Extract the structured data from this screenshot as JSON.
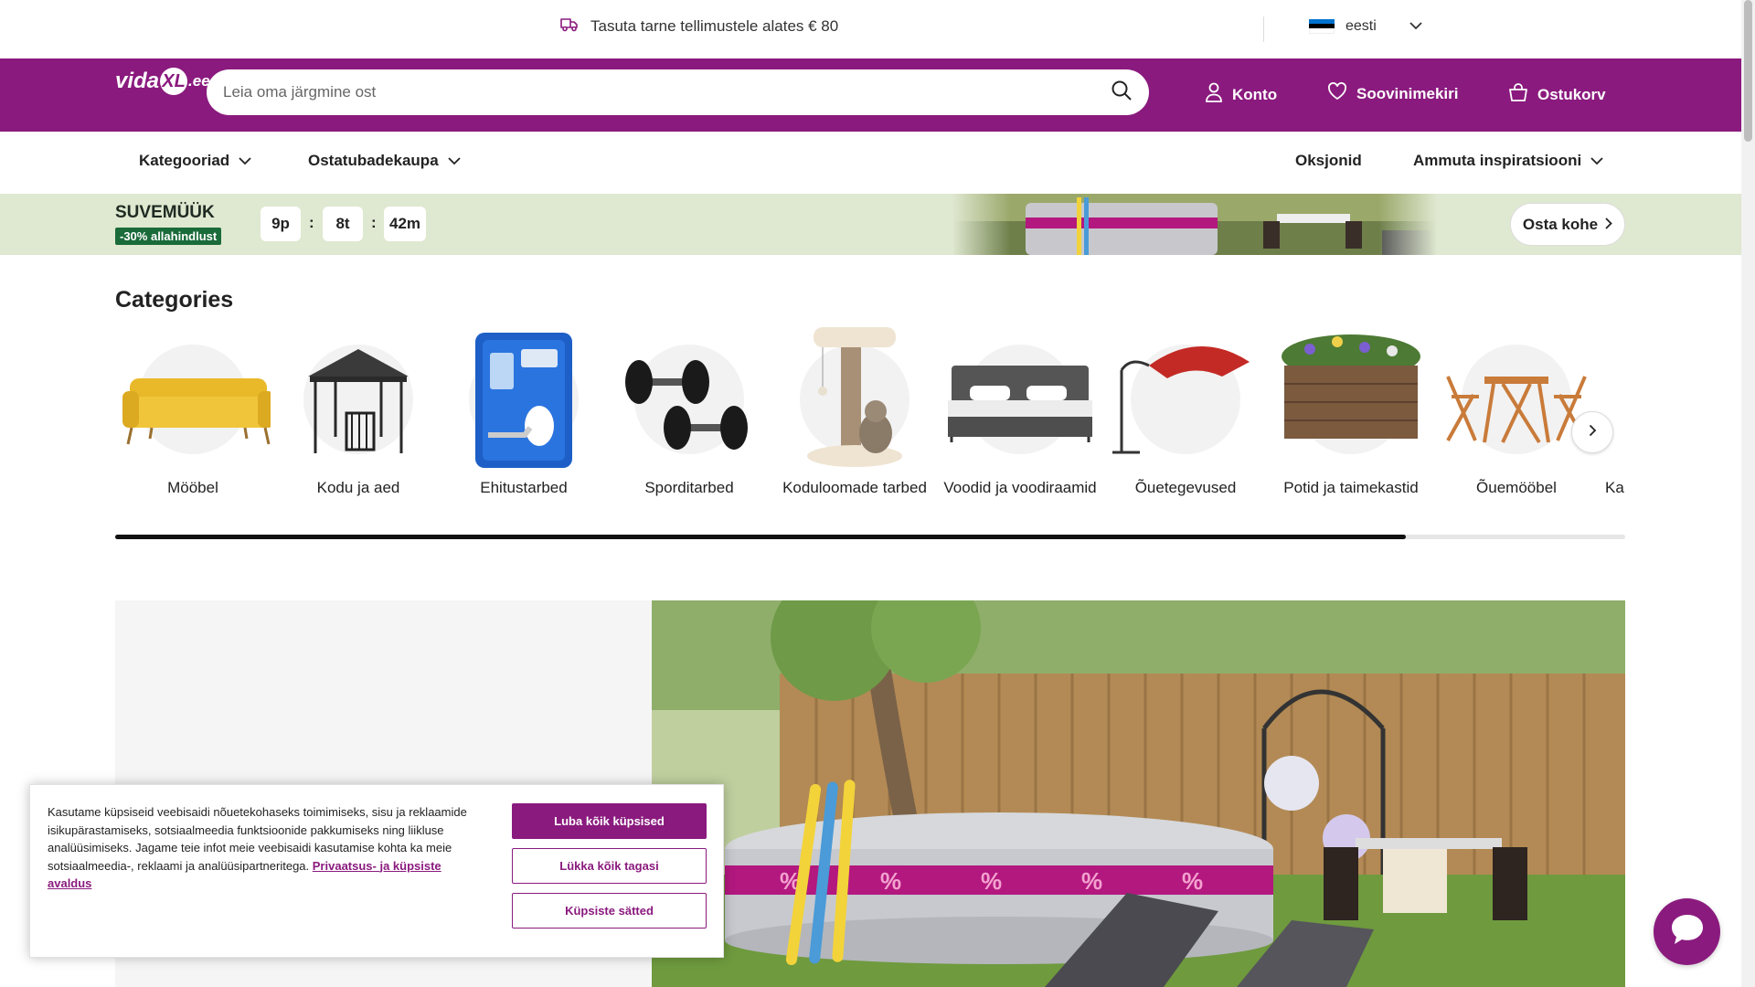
{
  "topbar": {
    "promo_icon": "delivery-truck-icon",
    "promo_text": "Tasuta tarne tellimustele alates € 80",
    "language": "eesti",
    "flag_colors": [
      "#0072ce",
      "#000000",
      "#ffffff"
    ]
  },
  "header": {
    "logo_text": "vidaXL.ee",
    "search_placeholder": "Leia oma järgmine ost",
    "account_label": "Konto",
    "wishlist_label": "Soovinimekiri",
    "cart_label": "Ostukorv",
    "brand_color": "#8a1a7e"
  },
  "nav": {
    "categories_label": "Kategooriad",
    "shop_by_room_label": "Ostatubadekaupa",
    "auctions_label": "Oksjonid",
    "inspiration_label": "Ammuta inspiratsiooni"
  },
  "sale_banner": {
    "title": "SUVEMÜÜK",
    "badge": "-30% allahindlust",
    "timer_days": "9p",
    "timer_hours": "8t",
    "timer_minutes": "42m",
    "separator": ":",
    "cta_label": "Osta kohe",
    "background_color": "#dfe8d0"
  },
  "categories": {
    "title": "Categories",
    "items": [
      {
        "label": "Mööbel",
        "icon": "sofa-icon"
      },
      {
        "label": "Kodu ja aed",
        "icon": "gazebo-icon"
      },
      {
        "label": "Ehitustarbed",
        "icon": "toolcase-icon"
      },
      {
        "label": "Sporditarbed",
        "icon": "dumbbell-icon"
      },
      {
        "label": "Koduloomade tarbed",
        "icon": "cat-tree-icon"
      },
      {
        "label": "Voodid ja voodiraamid",
        "icon": "bed-icon"
      },
      {
        "label": "Õuetegevused",
        "icon": "parasol-icon"
      },
      {
        "label": "Potid ja taimekastid",
        "icon": "planter-icon"
      },
      {
        "label": "Õuemööbel",
        "icon": "bistro-set-icon"
      },
      {
        "label": "Ka",
        "icon": "partial-item-icon"
      }
    ],
    "scroll_progress": 0.855
  },
  "cookie": {
    "text": "Kasutame küpsiseid veebisaidi nõuetekohaseks toimimiseks, sisu ja reklaamide isikupärastamiseks, sotsiaalmeedia funktsioonide pakkumiseks ning liikluse analüüsimiseks. Jagame teie infot meie veebisaidi kasutamise kohta ka meie sotsiaalmeedia-, reklaami ja analüüsipartneritega.",
    "link_text": "Privaatsus- ja küpsiste avaldus",
    "accept_label": "Luba kõik küpsised",
    "reject_label": "Lükka kõik tagasi",
    "settings_label": "Küpsiste sätted"
  },
  "chat": {
    "icon": "chat-bubble-icon"
  }
}
